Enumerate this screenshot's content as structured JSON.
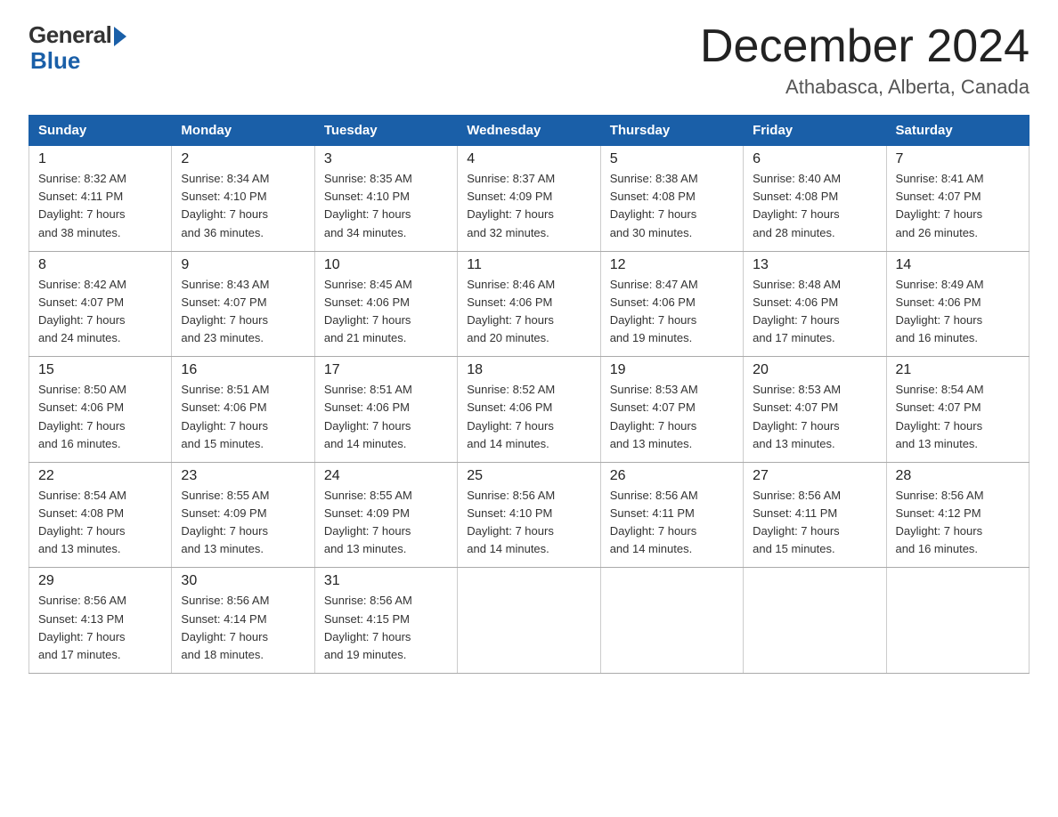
{
  "header": {
    "logo_general": "General",
    "logo_blue": "Blue",
    "month_title": "December 2024",
    "location": "Athabasca, Alberta, Canada"
  },
  "calendar": {
    "days_of_week": [
      "Sunday",
      "Monday",
      "Tuesday",
      "Wednesday",
      "Thursday",
      "Friday",
      "Saturday"
    ],
    "weeks": [
      [
        {
          "day": "1",
          "info": "Sunrise: 8:32 AM\nSunset: 4:11 PM\nDaylight: 7 hours\nand 38 minutes."
        },
        {
          "day": "2",
          "info": "Sunrise: 8:34 AM\nSunset: 4:10 PM\nDaylight: 7 hours\nand 36 minutes."
        },
        {
          "day": "3",
          "info": "Sunrise: 8:35 AM\nSunset: 4:10 PM\nDaylight: 7 hours\nand 34 minutes."
        },
        {
          "day": "4",
          "info": "Sunrise: 8:37 AM\nSunset: 4:09 PM\nDaylight: 7 hours\nand 32 minutes."
        },
        {
          "day": "5",
          "info": "Sunrise: 8:38 AM\nSunset: 4:08 PM\nDaylight: 7 hours\nand 30 minutes."
        },
        {
          "day": "6",
          "info": "Sunrise: 8:40 AM\nSunset: 4:08 PM\nDaylight: 7 hours\nand 28 minutes."
        },
        {
          "day": "7",
          "info": "Sunrise: 8:41 AM\nSunset: 4:07 PM\nDaylight: 7 hours\nand 26 minutes."
        }
      ],
      [
        {
          "day": "8",
          "info": "Sunrise: 8:42 AM\nSunset: 4:07 PM\nDaylight: 7 hours\nand 24 minutes."
        },
        {
          "day": "9",
          "info": "Sunrise: 8:43 AM\nSunset: 4:07 PM\nDaylight: 7 hours\nand 23 minutes."
        },
        {
          "day": "10",
          "info": "Sunrise: 8:45 AM\nSunset: 4:06 PM\nDaylight: 7 hours\nand 21 minutes."
        },
        {
          "day": "11",
          "info": "Sunrise: 8:46 AM\nSunset: 4:06 PM\nDaylight: 7 hours\nand 20 minutes."
        },
        {
          "day": "12",
          "info": "Sunrise: 8:47 AM\nSunset: 4:06 PM\nDaylight: 7 hours\nand 19 minutes."
        },
        {
          "day": "13",
          "info": "Sunrise: 8:48 AM\nSunset: 4:06 PM\nDaylight: 7 hours\nand 17 minutes."
        },
        {
          "day": "14",
          "info": "Sunrise: 8:49 AM\nSunset: 4:06 PM\nDaylight: 7 hours\nand 16 minutes."
        }
      ],
      [
        {
          "day": "15",
          "info": "Sunrise: 8:50 AM\nSunset: 4:06 PM\nDaylight: 7 hours\nand 16 minutes."
        },
        {
          "day": "16",
          "info": "Sunrise: 8:51 AM\nSunset: 4:06 PM\nDaylight: 7 hours\nand 15 minutes."
        },
        {
          "day": "17",
          "info": "Sunrise: 8:51 AM\nSunset: 4:06 PM\nDaylight: 7 hours\nand 14 minutes."
        },
        {
          "day": "18",
          "info": "Sunrise: 8:52 AM\nSunset: 4:06 PM\nDaylight: 7 hours\nand 14 minutes."
        },
        {
          "day": "19",
          "info": "Sunrise: 8:53 AM\nSunset: 4:07 PM\nDaylight: 7 hours\nand 13 minutes."
        },
        {
          "day": "20",
          "info": "Sunrise: 8:53 AM\nSunset: 4:07 PM\nDaylight: 7 hours\nand 13 minutes."
        },
        {
          "day": "21",
          "info": "Sunrise: 8:54 AM\nSunset: 4:07 PM\nDaylight: 7 hours\nand 13 minutes."
        }
      ],
      [
        {
          "day": "22",
          "info": "Sunrise: 8:54 AM\nSunset: 4:08 PM\nDaylight: 7 hours\nand 13 minutes."
        },
        {
          "day": "23",
          "info": "Sunrise: 8:55 AM\nSunset: 4:09 PM\nDaylight: 7 hours\nand 13 minutes."
        },
        {
          "day": "24",
          "info": "Sunrise: 8:55 AM\nSunset: 4:09 PM\nDaylight: 7 hours\nand 13 minutes."
        },
        {
          "day": "25",
          "info": "Sunrise: 8:56 AM\nSunset: 4:10 PM\nDaylight: 7 hours\nand 14 minutes."
        },
        {
          "day": "26",
          "info": "Sunrise: 8:56 AM\nSunset: 4:11 PM\nDaylight: 7 hours\nand 14 minutes."
        },
        {
          "day": "27",
          "info": "Sunrise: 8:56 AM\nSunset: 4:11 PM\nDaylight: 7 hours\nand 15 minutes."
        },
        {
          "day": "28",
          "info": "Sunrise: 8:56 AM\nSunset: 4:12 PM\nDaylight: 7 hours\nand 16 minutes."
        }
      ],
      [
        {
          "day": "29",
          "info": "Sunrise: 8:56 AM\nSunset: 4:13 PM\nDaylight: 7 hours\nand 17 minutes."
        },
        {
          "day": "30",
          "info": "Sunrise: 8:56 AM\nSunset: 4:14 PM\nDaylight: 7 hours\nand 18 minutes."
        },
        {
          "day": "31",
          "info": "Sunrise: 8:56 AM\nSunset: 4:15 PM\nDaylight: 7 hours\nand 19 minutes."
        },
        {
          "day": "",
          "info": ""
        },
        {
          "day": "",
          "info": ""
        },
        {
          "day": "",
          "info": ""
        },
        {
          "day": "",
          "info": ""
        }
      ]
    ]
  }
}
